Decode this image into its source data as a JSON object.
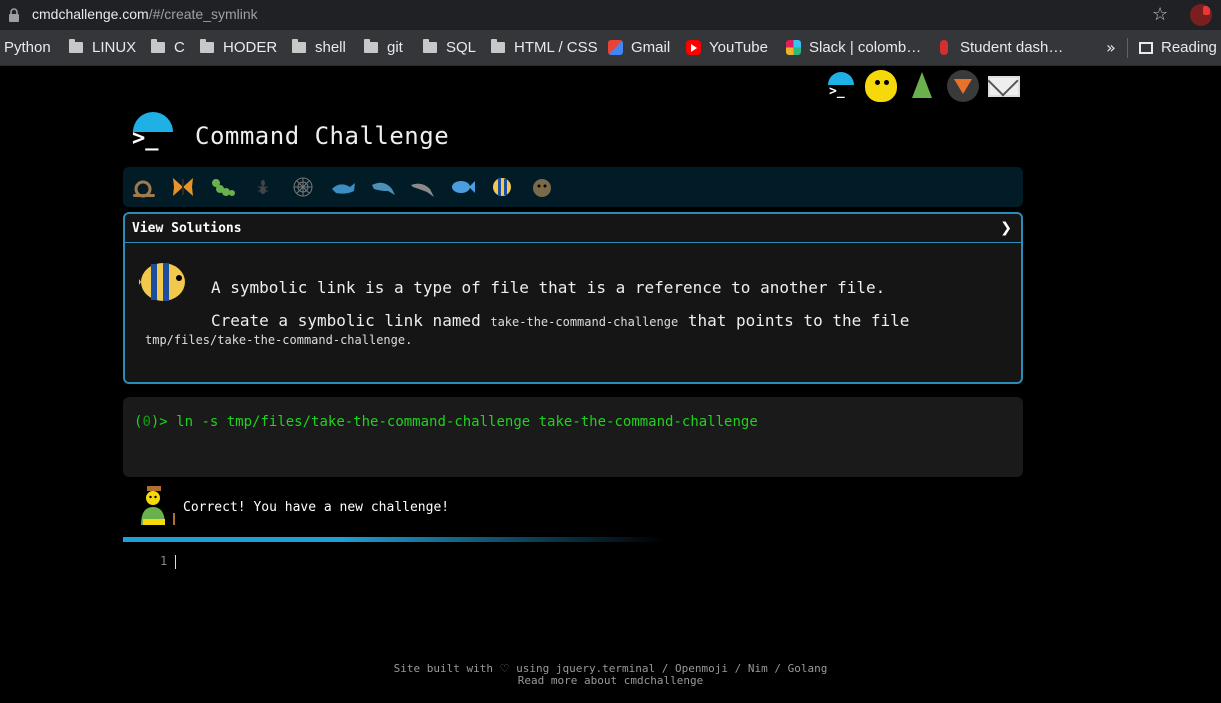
{
  "browser": {
    "url_domain": "cmdchallenge.com",
    "url_path": "/#/create_symlink",
    "bookmarks": [
      {
        "label": "Python",
        "icon": "none"
      },
      {
        "label": "LINUX",
        "icon": "folder-icon"
      },
      {
        "label": "C",
        "icon": "folder-icon"
      },
      {
        "label": "HODER",
        "icon": "folder-icon"
      },
      {
        "label": "shell",
        "icon": "folder-icon"
      },
      {
        "label": "git",
        "icon": "folder-icon"
      },
      {
        "label": "SQL",
        "icon": "folder-icon"
      },
      {
        "label": "HTML / CSS",
        "icon": "folder-icon"
      },
      {
        "label": "Gmail",
        "icon": "gmail-icon"
      },
      {
        "label": "YouTube",
        "icon": "youtube-icon"
      },
      {
        "label": "Slack | colomb…",
        "icon": "slack-icon"
      },
      {
        "label": "Student dash…",
        "icon": "student-icon"
      }
    ],
    "overflow": "»",
    "reading_list": "Reading"
  },
  "header": {
    "title": "Command Challenge",
    "logo_prompt": ">_"
  },
  "top_icons": [
    "terminal-icon",
    "face-icon",
    "tree-icon",
    "gitlab-icon",
    "mail-icon"
  ],
  "progress_emojis": [
    "snail",
    "butterfly",
    "caterpillar",
    "ant",
    "spider-web",
    "whale",
    "shark",
    "dolphin",
    "fish",
    "tropical-fish",
    "blowfish"
  ],
  "solutions": {
    "label": "View Solutions",
    "arrow": "❯"
  },
  "challenge": {
    "line1": "A symbolic link is a type of file that is a reference to another file.",
    "line2_prefix": "Create a symbolic link named ",
    "line2_code": "take-the-command-challenge",
    "line2_suffix": " that points to the file",
    "line3": "tmp/files/take-the-command-challenge."
  },
  "terminal": {
    "prompt_open": "(",
    "prompt_code": "0",
    "prompt_close": ")> ",
    "command": "ln -s tmp/files/take-the-command-challenge take-the-command-challenge"
  },
  "result": {
    "message": "Correct! You have a new challenge!"
  },
  "editor": {
    "line_number": "1"
  },
  "footer": {
    "line1_prefix": "Site built with ",
    "heart": "♡",
    "line1_suffix": " using jquery.terminal / Openmoji / Nim / Golang",
    "line2": "Read more about cmdchallenge"
  },
  "colors": {
    "accent": "#1fb0e6",
    "terminal_green": "#1fd21f",
    "panel_border": "#2a8db8"
  }
}
